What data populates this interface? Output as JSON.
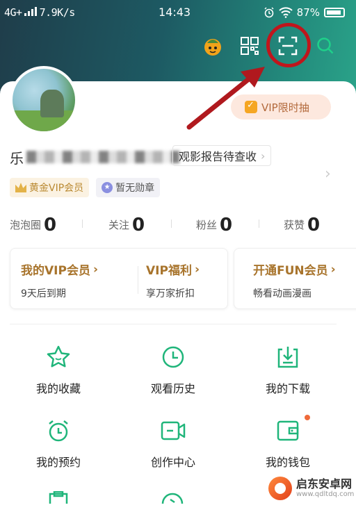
{
  "status_bar": {
    "network": "4G+",
    "speed": "7.9K/s",
    "time": "14:43",
    "battery": "87%"
  },
  "profile": {
    "name_first_char": "乐",
    "report_label": "观影报告待查收",
    "vip_pill_label": "VIP限时抽",
    "badges": [
      "黄金VIP会员",
      "暂无勋章"
    ]
  },
  "stats": [
    {
      "label": "泡泡圈",
      "value": "0"
    },
    {
      "label": "关注",
      "value": "0"
    },
    {
      "label": "粉丝",
      "value": "0"
    },
    {
      "label": "获赞",
      "value": "0"
    }
  ],
  "vip_row": [
    {
      "title": "我的VIP会员",
      "subtitle": "9天后到期"
    },
    {
      "title": "VIP福利",
      "subtitle": "享万家折扣"
    },
    {
      "title": "开通FUN会员",
      "subtitle": "畅看动画漫画"
    }
  ],
  "grid": [
    {
      "label": "我的收藏",
      "icon": "star-icon"
    },
    {
      "label": "观看历史",
      "icon": "clock-icon"
    },
    {
      "label": "我的下载",
      "icon": "download-icon"
    },
    {
      "label": "我的预约",
      "icon": "alarm-icon"
    },
    {
      "label": "创作中心",
      "icon": "video-camera-icon"
    },
    {
      "label": "我的钱包",
      "icon": "wallet-icon"
    }
  ],
  "watermark": {
    "title": "启东安卓网",
    "url": "www.qdltdq.com"
  },
  "colors": {
    "accent_green": "#1fb57a",
    "gold": "#a8742c",
    "highlight_red": "#c0161c"
  }
}
